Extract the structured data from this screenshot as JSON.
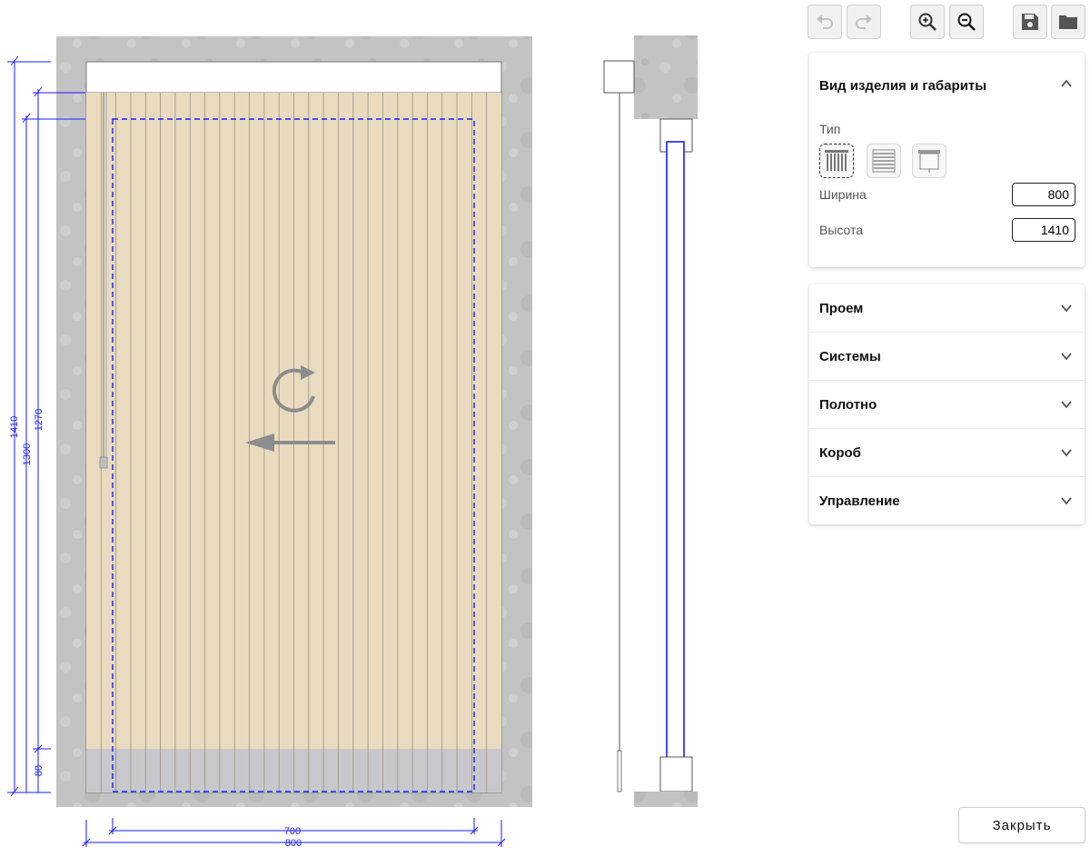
{
  "toolbar": {
    "undo": "undo-icon",
    "redo": "redo-icon",
    "zoom_in": "zoom-in-icon",
    "zoom_out": "zoom-out-icon",
    "save": "save-icon",
    "open": "folder-icon"
  },
  "panel": {
    "section_title": "Вид изделия и габариты",
    "type_label": "Тип",
    "types": [
      "vertical-blinds-icon",
      "horizontal-blinds-icon",
      "roller-blind-icon"
    ],
    "active_type": 0,
    "width_label": "Ширина",
    "width_value": "800",
    "height_label": "Высота",
    "height_value": "1410",
    "sections": [
      "Проем",
      "Системы",
      "Полотно",
      "Короб",
      "Управление"
    ],
    "close_label": "Закрыть"
  },
  "drawing": {
    "dims": {
      "d1410": "1410",
      "d1300": "1300",
      "d1270": "1270",
      "d80": "80",
      "d700": "700",
      "d800": "800"
    },
    "slat_count": 28,
    "colors": {
      "wall": "#c2c2c2",
      "fabric": "#e8dbc0",
      "bottom_band": "#c8c8cc",
      "dimension": "#1a1aff",
      "arrow": "#8c8c8c"
    }
  }
}
